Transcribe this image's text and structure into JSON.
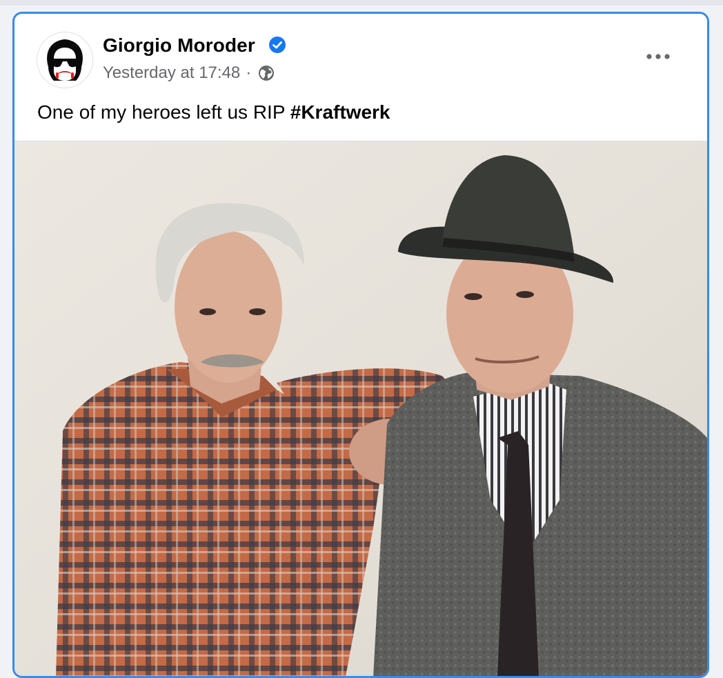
{
  "post": {
    "author": "Giorgio Moroder",
    "timestamp": "Yesterday at 17:48",
    "separator": "·",
    "audience_icon": "globe-icon",
    "verified_icon": "verified-badge-icon",
    "more_icon": "more-options-icon",
    "caption_text": "One of my heroes left us RIP ",
    "hashtag": "#Kraftwerk",
    "photo_alt": "Photo of two men standing against a white wall"
  },
  "colors": {
    "accent_border": "#3a8ae8",
    "verified": "#1877f2",
    "secondary_text": "#65676b",
    "primary_text": "#050505"
  }
}
